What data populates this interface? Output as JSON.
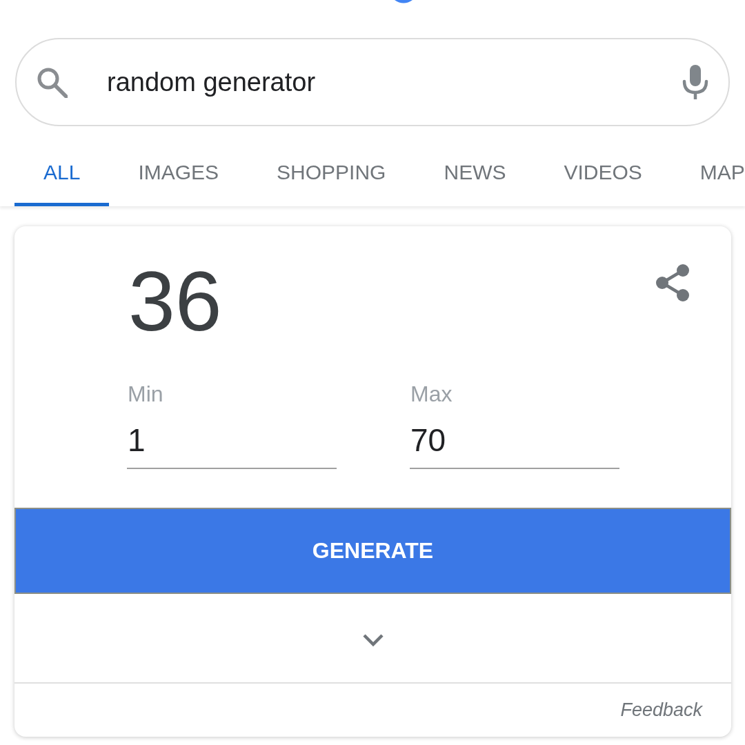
{
  "search": {
    "value": "random generator"
  },
  "tabs": [
    {
      "label": "ALL",
      "selected": true
    },
    {
      "label": "IMAGES",
      "selected": false
    },
    {
      "label": "SHOPPING",
      "selected": false
    },
    {
      "label": "NEWS",
      "selected": false
    },
    {
      "label": "VIDEOS",
      "selected": false
    },
    {
      "label": "MAP",
      "selected": false
    }
  ],
  "generator": {
    "result": "36",
    "fields": [
      {
        "label": "Min",
        "value": "1"
      },
      {
        "label": "Max",
        "value": "70"
      }
    ],
    "button": "GENERATE",
    "expanded": false,
    "feedback": "Feedback"
  }
}
